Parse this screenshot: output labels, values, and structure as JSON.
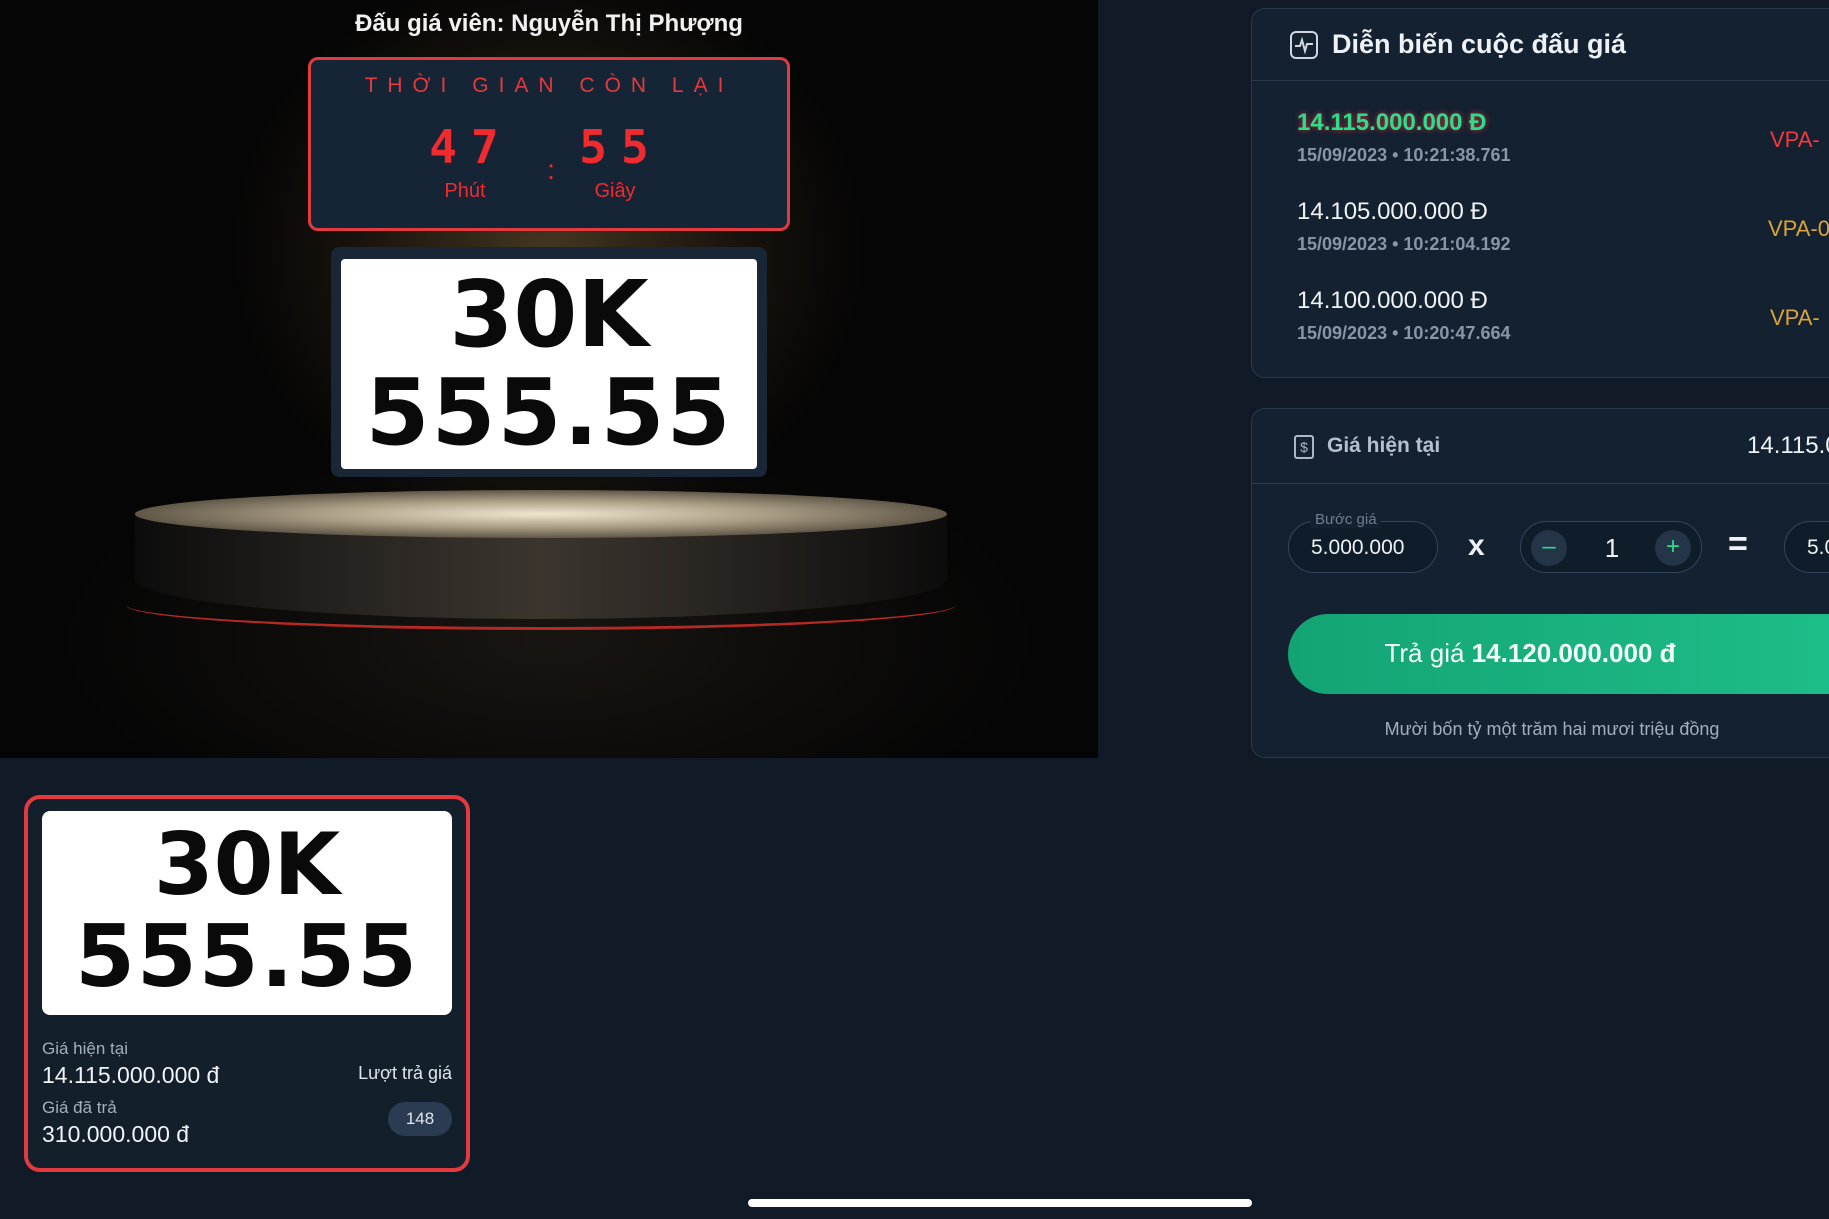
{
  "stage": {
    "auctioneer": "Đấu giá viên: Nguyễn Thị Phượng",
    "timer": {
      "title": "THỜI GIAN CÒN LẠI",
      "minutes": "47",
      "minutes_label": "Phút",
      "separator": ":",
      "seconds": "55",
      "seconds_label": "Giây"
    },
    "plate": {
      "line1": "30K",
      "line2": "555.55"
    }
  },
  "history": {
    "title": "Diễn biến cuộc đấu giá",
    "bids": [
      {
        "amount": "14.115.000.000 Đ",
        "time": "15/09/2023 • 10:21:38.761",
        "user": "VPA-"
      },
      {
        "amount": "14.105.000.000 Đ",
        "time": "15/09/2023 • 10:21:04.192",
        "user": "VPA-0"
      },
      {
        "amount": "14.100.000.000 Đ",
        "time": "15/09/2023 • 10:20:47.664",
        "user": "VPA-"
      }
    ]
  },
  "bidding": {
    "current_label": "Giá hiện tại",
    "current_value": "14.115.0",
    "step_label": "Bước giá",
    "step_value": "5.000.000",
    "multiply": "x",
    "minus": "–",
    "quantity": "1",
    "plus": "+",
    "equals": "=",
    "total_value": "5.0",
    "button_prefix": "Trả giá",
    "button_amount": "14.120.000.000 đ",
    "amount_words": "Mười bốn tỷ một trăm hai mươi triệu đồng"
  },
  "card": {
    "plate": {
      "line1": "30K",
      "line2": "555.55"
    },
    "current_label": "Giá hiện tại",
    "current_value": "14.115.000.000 đ",
    "paid_label": "Giá đã trả",
    "paid_value": "310.000.000 đ",
    "bid_count_label": "Lượt trả giá",
    "bid_count": "148"
  },
  "colors": {
    "accent_green": "#2ddd8a",
    "alert_red": "#e23a3f",
    "user_gold": "#d9a43a",
    "background": "#111a27"
  }
}
